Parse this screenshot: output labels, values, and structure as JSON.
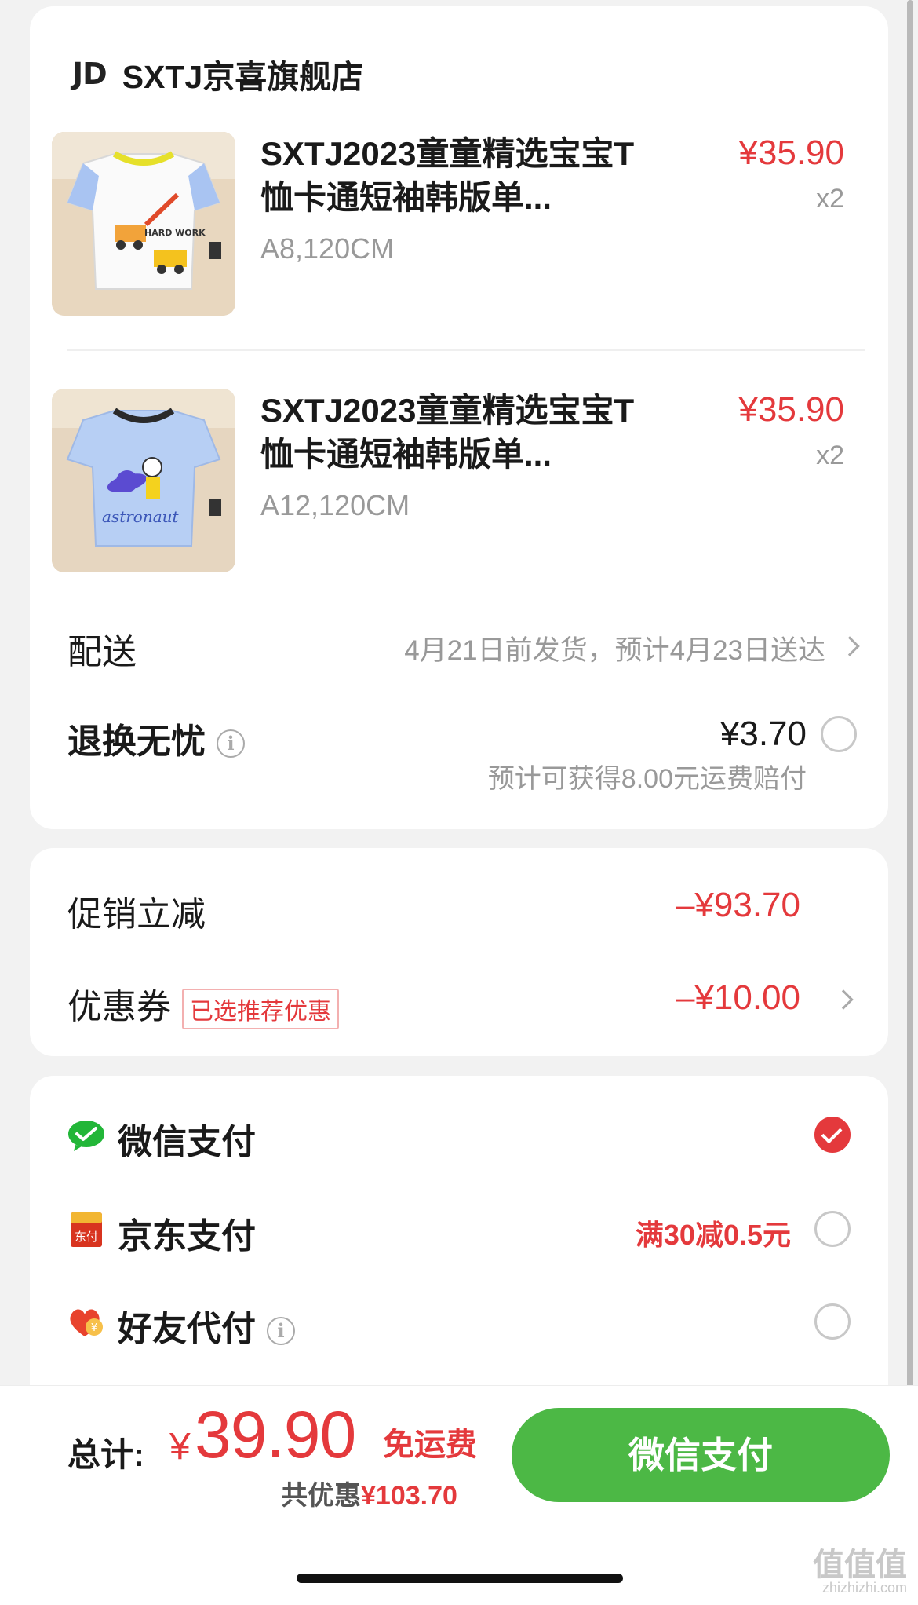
{
  "store": {
    "logo_text": "JD",
    "name": "SXTJ京喜旗舰店"
  },
  "products": [
    {
      "title": "SXTJ2023童童精选宝宝T恤卡通短袖韩版单...",
      "spec": "A8,120CM",
      "price": "¥35.90",
      "qty": "x2",
      "image_icon": "white-tshirt-excavator-thumbnail",
      "image_text": "HARD WORK"
    },
    {
      "title": "SXTJ2023童童精选宝宝T恤卡通短袖韩版单...",
      "spec": "A12,120CM",
      "price": "¥35.90",
      "qty": "x2",
      "image_icon": "blue-tshirt-astronaut-thumbnail",
      "image_text": "astronaut"
    }
  ],
  "delivery": {
    "label": "配送",
    "value": "4月21日前发货，预计4月23日送达"
  },
  "returns": {
    "label": "退换无忧",
    "price": "¥3.70",
    "note": "预计可获得8.00元运费赔付"
  },
  "discounts": {
    "promo_label": "促销立减",
    "promo_amount": "–¥93.70",
    "coupon_label": "优惠券",
    "coupon_tag": "已选推荐优惠",
    "coupon_amount": "–¥10.00"
  },
  "payment_methods": [
    {
      "label": "微信支付",
      "icon": "wechat-pay-icon",
      "promo": "",
      "selected": true
    },
    {
      "label": "京东支付",
      "icon": "jd-pay-icon",
      "icon_text": "东付",
      "promo": "满30减0.5元",
      "selected": false
    },
    {
      "label": "好友代付",
      "icon": "friend-pay-heart-icon",
      "icon_text": "¥",
      "promo": "",
      "selected": false
    }
  ],
  "summary": {
    "total_label": "总计:",
    "currency": "¥",
    "total_amount": "39.90",
    "free_shipping": "免运费",
    "saved_label": "共优惠",
    "saved_amount": "¥103.70",
    "pay_button": "微信支付"
  },
  "watermark": {
    "text": "值值值",
    "sub": "zhizhizhi.com"
  },
  "colors": {
    "accent_red": "#e4393c",
    "wechat_green": "#4cb845",
    "muted_gray": "#999999"
  }
}
